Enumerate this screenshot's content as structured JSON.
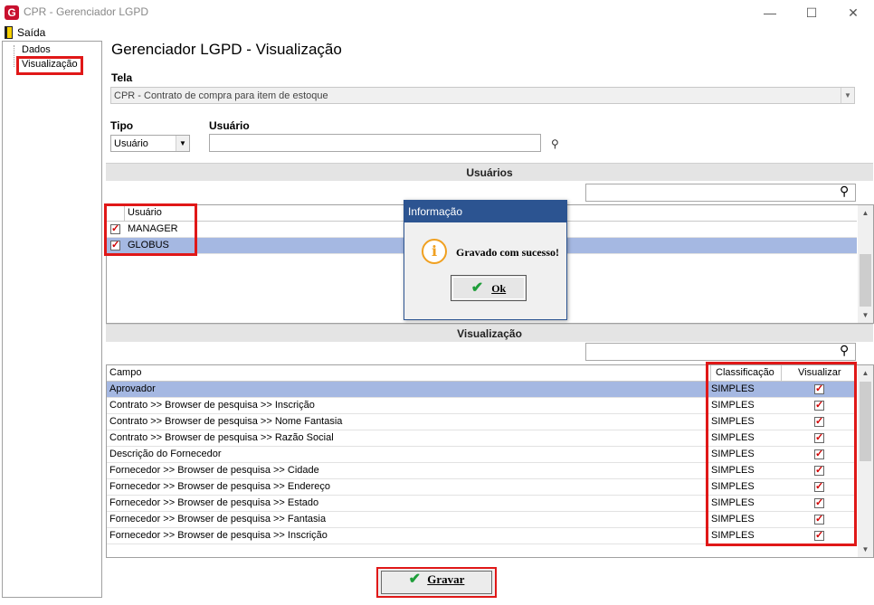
{
  "window": {
    "title": "CPR - Gerenciador LGPD",
    "icon_letter": "G",
    "minimize_glyph": "—",
    "maximize_glyph": "☐",
    "close_glyph": "✕"
  },
  "menu": {
    "exit_label": "Saída"
  },
  "tree": {
    "items": [
      {
        "label": "Dados"
      },
      {
        "label": "Visualização"
      }
    ]
  },
  "main": {
    "title": "Gerenciador LGPD - Visualização",
    "tela_label": "Tela",
    "tela_value": "CPR - Contrato de compra para item de estoque",
    "tipo_label": "Tipo",
    "tipo_value": "Usuário",
    "usuario_label": "Usuário",
    "usuario_value": ""
  },
  "users_section": {
    "title": "Usuários",
    "search_value": "",
    "column_header": "Usuário",
    "rows": [
      {
        "name": "MANAGER",
        "checked": true
      },
      {
        "name": "GLOBUS",
        "checked": true
      }
    ]
  },
  "visualization_section": {
    "title": "Visualização",
    "search_value": "",
    "headers": {
      "campo": "Campo",
      "classificacao": "Classificação",
      "visualizar": "Visualizar"
    },
    "rows": [
      {
        "campo": "Aprovador",
        "classificacao": "SIMPLES",
        "visualizar": true
      },
      {
        "campo": "Contrato >> Browser de pesquisa >> Inscrição",
        "classificacao": "SIMPLES",
        "visualizar": true
      },
      {
        "campo": "Contrato >> Browser de pesquisa >> Nome Fantasia",
        "classificacao": "SIMPLES",
        "visualizar": true
      },
      {
        "campo": "Contrato >> Browser de pesquisa >> Razão Social",
        "classificacao": "SIMPLES",
        "visualizar": true
      },
      {
        "campo": "Descrição do Fornecedor",
        "classificacao": "SIMPLES",
        "visualizar": true
      },
      {
        "campo": "Fornecedor >> Browser de pesquisa >> Cidade",
        "classificacao": "SIMPLES",
        "visualizar": true
      },
      {
        "campo": "Fornecedor >> Browser de pesquisa >> Endereço",
        "classificacao": "SIMPLES",
        "visualizar": true
      },
      {
        "campo": "Fornecedor >> Browser de pesquisa >> Estado",
        "classificacao": "SIMPLES",
        "visualizar": true
      },
      {
        "campo": "Fornecedor >> Browser de pesquisa >> Fantasia",
        "classificacao": "SIMPLES",
        "visualizar": true
      },
      {
        "campo": "Fornecedor >> Browser de pesquisa >> Inscrição",
        "classificacao": "SIMPLES",
        "visualizar": true
      }
    ]
  },
  "dialog": {
    "title": "Informação",
    "icon_glyph": "i",
    "message": "Gravado com sucesso!",
    "ok_label": "Ok"
  },
  "save_button": {
    "label": "Gravar"
  },
  "colors": {
    "selection": "#a5b8e2",
    "highlight_border": "#e01818",
    "dialog_title": "#2c5491",
    "check_red": "#d00000",
    "check_green": "#1f9e3a"
  }
}
